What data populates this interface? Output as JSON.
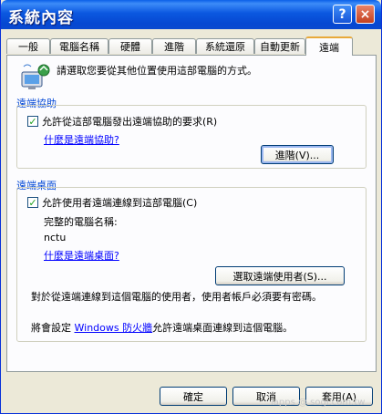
{
  "window": {
    "title": "系統內容",
    "help_label": "?",
    "close_label": "×"
  },
  "tabs": [
    {
      "label": "一般"
    },
    {
      "label": "電腦名稱"
    },
    {
      "label": "硬體"
    },
    {
      "label": "進階"
    },
    {
      "label": "系統還原"
    },
    {
      "label": "自動更新"
    },
    {
      "label": "遠端"
    }
  ],
  "intro": {
    "text": "請選取您要從其他位置使用這部電腦的方式。",
    "icon": "computer-remote-icon"
  },
  "remote_assistance": {
    "heading": "遠端協助",
    "checkbox_label": "允許從這部電腦發出遠端協助的要求(R)",
    "checked": true,
    "link": "什麼是遠端協助?",
    "advanced_button": "進階(V)..."
  },
  "remote_desktop": {
    "heading": "遠端桌面",
    "checkbox_label": "允許使用者遠端連線到這部電腦(C)",
    "checked": true,
    "full_name_label": "完整的電腦名稱:",
    "computer_name": "nctu",
    "link": "什麼是遠端桌面?",
    "select_users_button": "選取遠端使用者(S)...",
    "note": "對於從遠端連線到這個電腦的使用者，使用者帳戶必須要有密碼。",
    "firewall_prefix": "將會設定",
    "firewall_link": "Windows 防火牆",
    "firewall_suffix": "允許遠端桌面連線到這個電腦。"
  },
  "buttons": {
    "ok": "確定",
    "cancel": "取消",
    "apply": "套用(A)"
  },
  "watermark": "iapps @ sogi.com.tw",
  "colors": {
    "title_bar": "#0a5fe8",
    "group_heading": "#0046d5",
    "link": "#0000ff",
    "active_tab_accent": "#e8a93a"
  }
}
